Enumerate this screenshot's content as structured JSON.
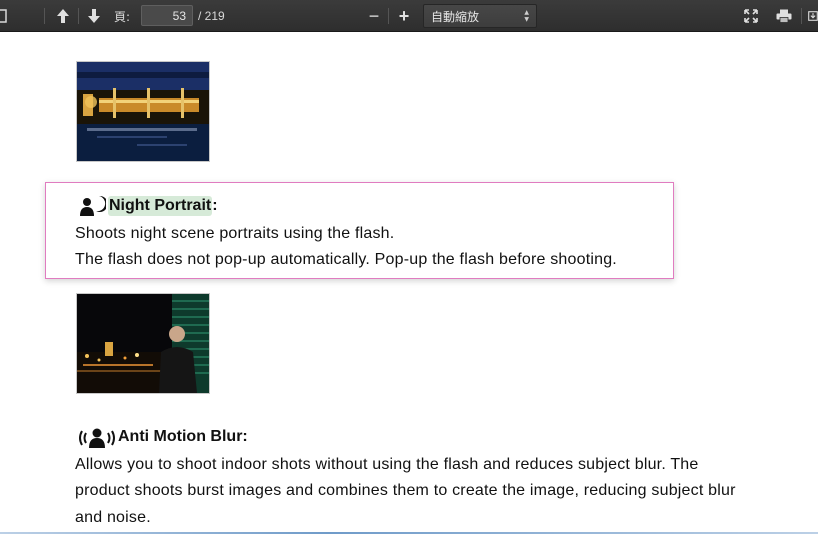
{
  "toolbar": {
    "page_label": "頁:",
    "page_value": "53",
    "page_total": "/ 219",
    "zoom_minus": "−",
    "zoom_plus": "+",
    "zoom_value": "自動縮放"
  },
  "content": {
    "night_portrait": {
      "title": "Night Portrait",
      "colon": ":",
      "line1": "Shoots night scene portraits using the flash.",
      "line2": "The flash does not pop-up automatically. Pop-up the flash before shooting."
    },
    "anti_motion_blur": {
      "title": "Anti Motion Blur:",
      "line1": "Allows you to shoot indoor shots without using the flash and reduces subject blur. The",
      "line2": "product shoots burst images and combines them to create the image, reducing subject blur",
      "line3": "and noise."
    }
  },
  "icons": {
    "sidebar": "sidebar-toggle-icon",
    "prev": "arrow-up-icon",
    "next": "arrow-down-icon",
    "fullscreen": "fullscreen-icon",
    "print": "print-icon",
    "download": "download-icon",
    "night_portrait": "night-portrait-icon",
    "anti_motion_blur": "anti-motion-blur-icon"
  }
}
